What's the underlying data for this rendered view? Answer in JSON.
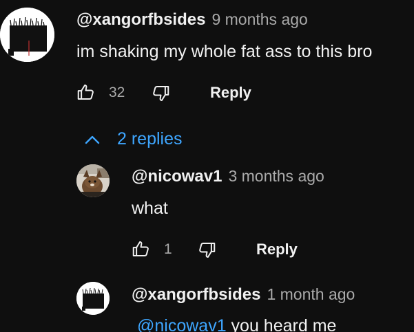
{
  "comment": {
    "author": "@xangorfbsides",
    "time": "9 months ago",
    "text": "im shaking my whole fat ass to this bro",
    "like_count": "32",
    "reply_label": "Reply"
  },
  "replies_toggle": {
    "label": "2 replies"
  },
  "replies": [
    {
      "author": "@nicowav1",
      "time": "3 months ago",
      "text": "what",
      "like_count": "1",
      "reply_label": "Reply"
    },
    {
      "author": "@xangorfbsides",
      "time": "1 month ago",
      "mention": "@nicowav1",
      "text": " you heard me"
    }
  ],
  "colors": {
    "background": "#0f0f0f",
    "text": "#f1f1f1",
    "secondary": "#aaaaaa",
    "link": "#3ea6ff"
  },
  "icons": {
    "like": "thumbs-up-icon",
    "dislike": "thumbs-down-icon",
    "toggle": "chevron-up-icon"
  }
}
